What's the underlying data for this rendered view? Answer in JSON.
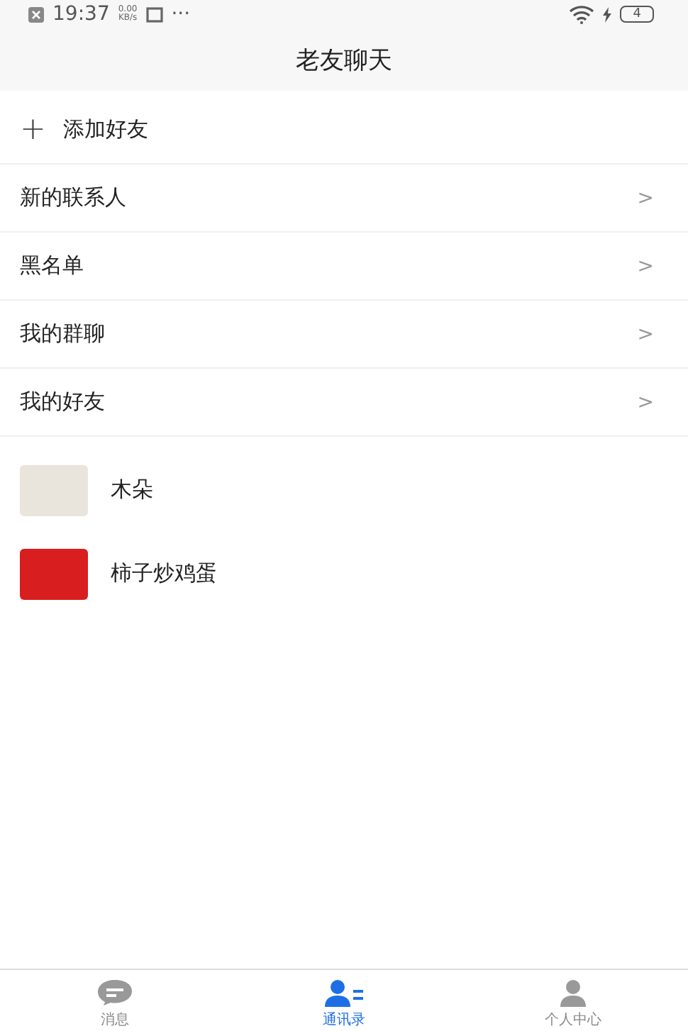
{
  "status_bar": {
    "time": "19:37",
    "speed": "0.00",
    "speed_unit": "KB/s",
    "more": "···",
    "battery": "4"
  },
  "header": {
    "title": "老友聊天"
  },
  "add_friend": {
    "icon": "+",
    "label": "添加好友"
  },
  "menu": [
    {
      "label": "新的联系人",
      "chevron": ">"
    },
    {
      "label": "黑名单",
      "chevron": ">"
    },
    {
      "label": "我的群聊",
      "chevron": ">"
    },
    {
      "label": "我的好友",
      "chevron": ">"
    }
  ],
  "contacts": [
    {
      "name": "木朵",
      "color": "#e9e4dc"
    },
    {
      "name": "柿子炒鸡蛋",
      "color": "#d81e1e"
    }
  ],
  "tab_bar": [
    {
      "label": "消息",
      "kind": "chat",
      "selected": false
    },
    {
      "label": "通讯录",
      "kind": "contacts",
      "selected": true
    },
    {
      "label": "个人中心",
      "kind": "person",
      "selected": false
    }
  ]
}
